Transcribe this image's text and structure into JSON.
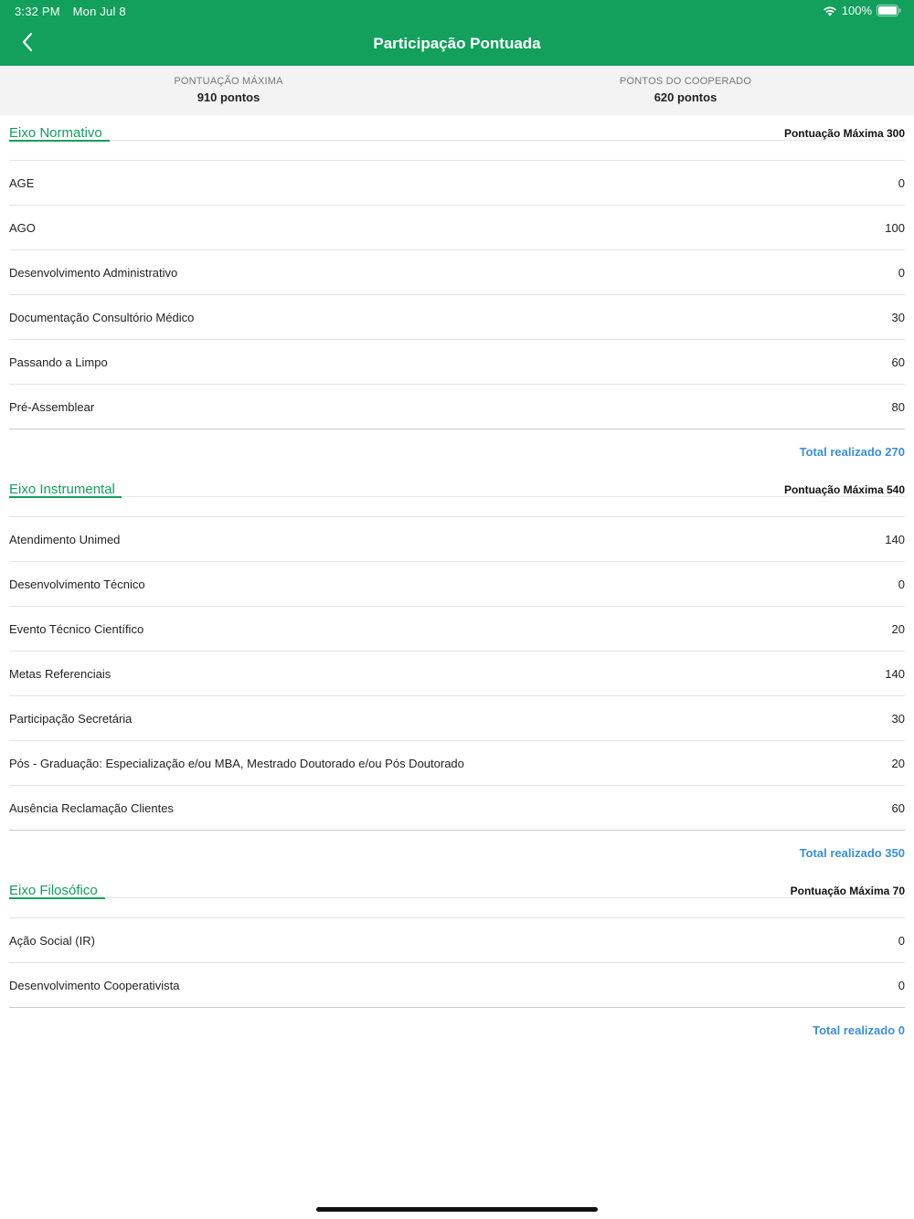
{
  "status_bar": {
    "time": "3:32 PM",
    "date": "Mon Jul 8",
    "battery": "100%"
  },
  "nav": {
    "title": "Participação Pontuada"
  },
  "summary": {
    "max_label": "PONTUAÇÃO MÁXIMA",
    "max_value": "910 pontos",
    "coop_label": "PONTOS DO COOPERADO",
    "coop_value": "620 pontos"
  },
  "sections": [
    {
      "title": "Eixo Normativo",
      "max": "Pontuação Máxima 300",
      "items": [
        {
          "label": "AGE",
          "value": "0"
        },
        {
          "label": "AGO",
          "value": "100"
        },
        {
          "label": "Desenvolvimento Administrativo",
          "value": "0"
        },
        {
          "label": "Documentação Consultório Médico",
          "value": "30"
        },
        {
          "label": "Passando a Limpo",
          "value": "60"
        },
        {
          "label": "Pré-Assemblear",
          "value": "80"
        }
      ],
      "total": "Total realizado 270"
    },
    {
      "title": "Eixo Instrumental",
      "max": "Pontuação Máxima 540",
      "items": [
        {
          "label": "Atendimento Unimed",
          "value": "140"
        },
        {
          "label": "Desenvolvimento Técnico",
          "value": "0"
        },
        {
          "label": "Evento Técnico Científico",
          "value": "20"
        },
        {
          "label": "Metas Referenciais",
          "value": "140"
        },
        {
          "label": "Participação Secretária",
          "value": "30"
        },
        {
          "label": "Pós - Graduação: Especialização e/ou MBA, Mestrado Doutorado e/ou Pós Doutorado",
          "value": "20"
        },
        {
          "label": "Ausência Reclamação Clientes",
          "value": "60"
        }
      ],
      "total": "Total realizado 350"
    },
    {
      "title": "Eixo Filosófico",
      "max": "Pontuação Máxima 70",
      "items": [
        {
          "label": "Ação Social (IR)",
          "value": "0"
        },
        {
          "label": "Desenvolvimento Cooperativista",
          "value": "0"
        }
      ],
      "total": "Total realizado 0"
    }
  ],
  "colors": {
    "brand_green": "#12a05c",
    "total_blue": "#3a8fd6"
  }
}
